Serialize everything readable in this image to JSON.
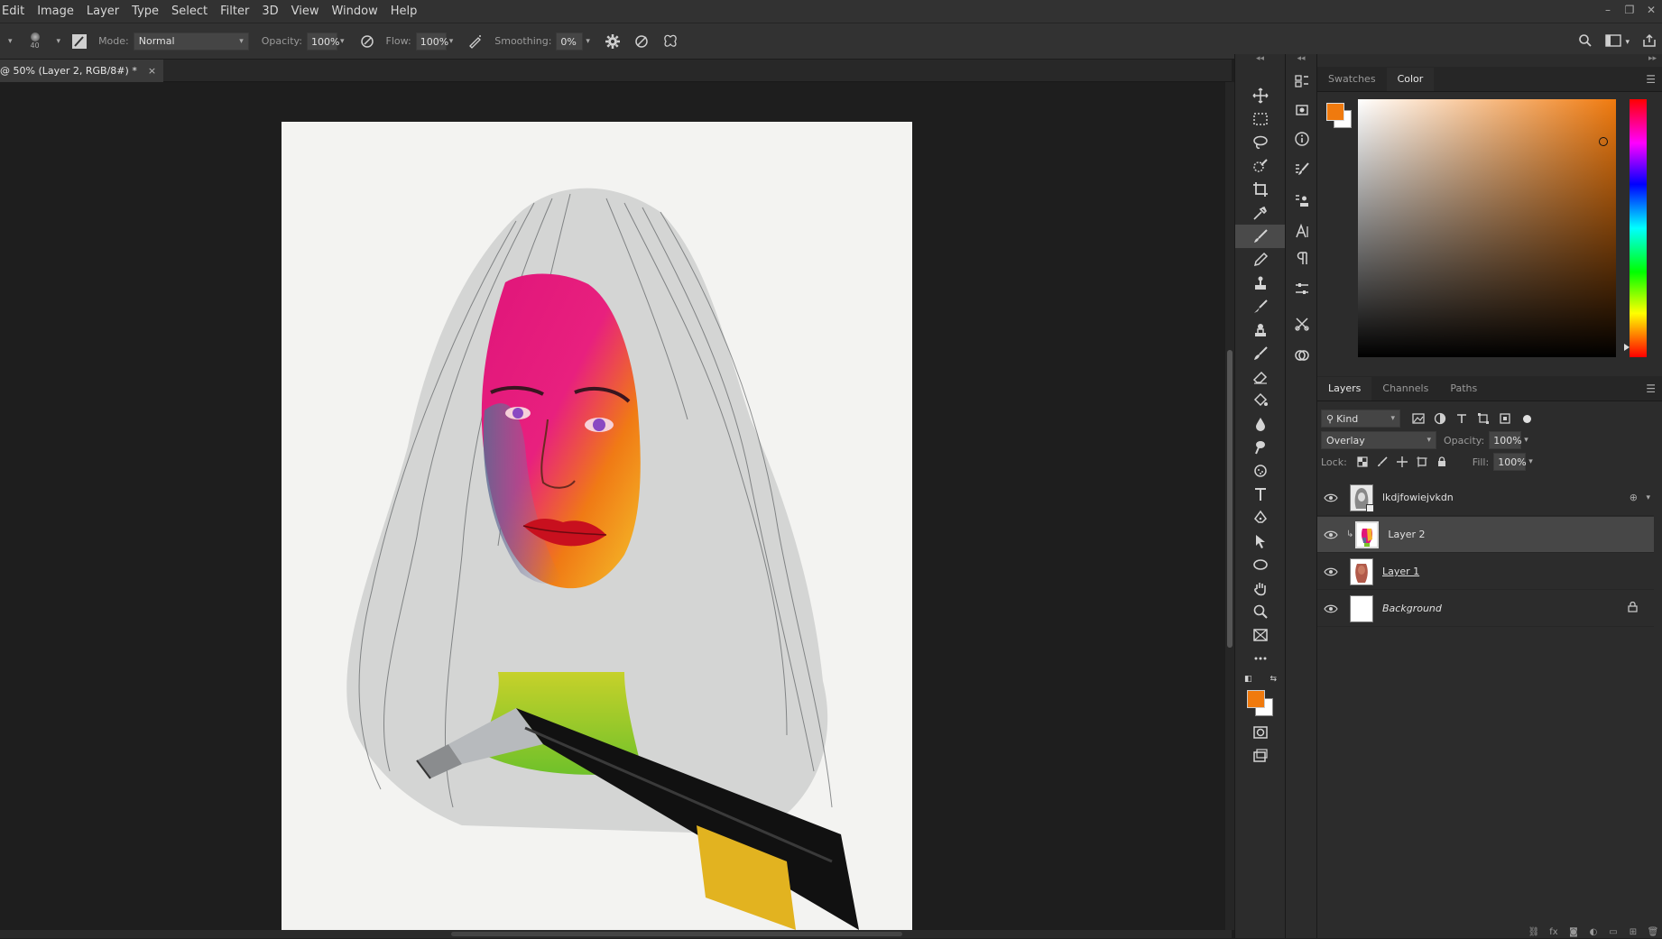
{
  "menu": [
    "Edit",
    "Image",
    "Layer",
    "Type",
    "Select",
    "Filter",
    "3D",
    "View",
    "Window",
    "Help"
  ],
  "window_controls": {
    "minimize": "–",
    "restore": "❐",
    "close": "✕"
  },
  "options": {
    "brush_size": "40",
    "mode_label": "Mode:",
    "mode_value": "Normal",
    "opacity_label": "Opacity:",
    "opacity_value": "100%",
    "flow_label": "Flow:",
    "flow_value": "100%",
    "smoothing_label": "Smoothing:",
    "smoothing_value": "0%"
  },
  "document_tab": {
    "title": "@ 50% (Layer 2, RGB/8#) *",
    "close": "×"
  },
  "color_panel": {
    "tabs": [
      "Swatches",
      "Color"
    ],
    "active_tab": "Color",
    "foreground": "#f07a0e",
    "background": "#ffffff"
  },
  "layers_panel": {
    "tabs": [
      "Layers",
      "Channels",
      "Paths"
    ],
    "active_tab": "Layers",
    "filter_kind": "Kind",
    "blend_mode": "Overlay",
    "opacity_label": "Opacity:",
    "opacity_value": "100%",
    "lock_label": "Lock:",
    "fill_label": "Fill:",
    "fill_value": "100%",
    "layers": [
      {
        "name": "lkdjfowiejvkdn",
        "visible": true,
        "selected": false
      },
      {
        "name": "Layer 2",
        "visible": true,
        "selected": true
      },
      {
        "name": "Layer 1",
        "visible": true,
        "selected": false
      },
      {
        "name": "Background",
        "visible": true,
        "selected": false,
        "locked": true
      }
    ]
  },
  "colors": {
    "chrome_dark": "#1e1e1e",
    "chrome_panel": "#2c2c2c",
    "chrome_bar": "#323232",
    "accent_orange": "#f07a0e"
  }
}
